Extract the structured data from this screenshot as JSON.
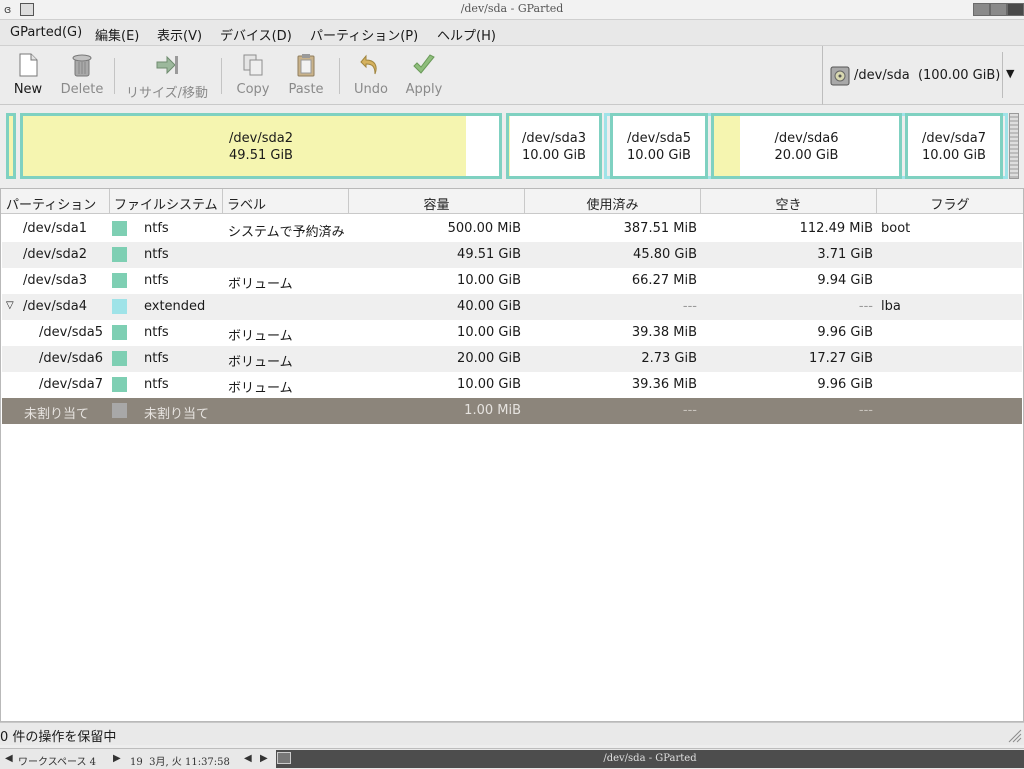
{
  "window": {
    "title": "/dev/sda - GParted"
  },
  "menubar": {
    "items": [
      {
        "label": "GParted(G)"
      },
      {
        "label": "編集(E)"
      },
      {
        "label": "表示(V)"
      },
      {
        "label": "デバイス(D)"
      },
      {
        "label": "パーティション(P)"
      },
      {
        "label": "ヘルプ(H)"
      }
    ]
  },
  "toolbar": {
    "new": "New",
    "delete": "Delete",
    "resize": "リサイズ/移動",
    "copy": "Copy",
    "paste": "Paste",
    "undo": "Undo",
    "apply": "Apply"
  },
  "device": {
    "label": "/dev/sda  (100.00 GiB)"
  },
  "diskmap": {
    "segments": [
      {
        "name": "/dev/sda2",
        "size": "49.51 GiB",
        "used_fraction": 0.93
      },
      {
        "name": "/dev/sda3",
        "size": "10.00 GiB",
        "used_fraction": 0.01
      },
      {
        "name": "/dev/sda5",
        "size": "10.00 GiB",
        "used_fraction": 0.0
      },
      {
        "name": "/dev/sda6",
        "size": "20.00 GiB",
        "used_fraction": 0.14
      },
      {
        "name": "/dev/sda7",
        "size": "10.00 GiB",
        "used_fraction": 0.0
      }
    ]
  },
  "table": {
    "headers": [
      "パーティション",
      "ファイルシステム",
      "ラベル",
      "容量",
      "使用済み",
      "空き",
      "フラグ"
    ],
    "rows": [
      {
        "partition": "/dev/sda1",
        "fs": "ntfs",
        "label": "システムで予約済み",
        "size": "500.00 MiB",
        "used": "387.51 MiB",
        "free": "112.49 MiB",
        "flags": "boot"
      },
      {
        "partition": "/dev/sda2",
        "fs": "ntfs",
        "label": "",
        "size": "49.51 GiB",
        "used": "45.80 GiB",
        "free": "3.71 GiB",
        "flags": ""
      },
      {
        "partition": "/dev/sda3",
        "fs": "ntfs",
        "label": "ボリューム",
        "size": "10.00 GiB",
        "used": "66.27 MiB",
        "free": "9.94 GiB",
        "flags": ""
      },
      {
        "partition": "/dev/sda4",
        "fs": "extended",
        "label": "",
        "size": "40.00 GiB",
        "used": "---",
        "free": "---",
        "flags": "lba"
      },
      {
        "partition": "/dev/sda5",
        "fs": "ntfs",
        "label": "ボリューム",
        "size": "10.00 GiB",
        "used": "39.38 MiB",
        "free": "9.96 GiB",
        "flags": ""
      },
      {
        "partition": "/dev/sda6",
        "fs": "ntfs",
        "label": "ボリューム",
        "size": "20.00 GiB",
        "used": "2.73 GiB",
        "free": "17.27 GiB",
        "flags": ""
      },
      {
        "partition": "/dev/sda7",
        "fs": "ntfs",
        "label": "ボリューム",
        "size": "10.00 GiB",
        "used": "39.36 MiB",
        "free": "9.96 GiB",
        "flags": ""
      },
      {
        "partition": "未割り当て",
        "fs": "未割り当て",
        "label": "",
        "size": "1.00 MiB",
        "used": "---",
        "free": "---",
        "flags": ""
      }
    ]
  },
  "colors": {
    "ntfs": "#7ecfb3",
    "extended": "#9fe3e8",
    "unallocated": "#a8a8a8"
  },
  "status": {
    "pending": "0 件の操作を保留中"
  },
  "taskbar": {
    "workspace": "ワークスペース 4",
    "clock": "19  3月, 火 11:37:58",
    "window": "/dev/sda - GParted"
  }
}
